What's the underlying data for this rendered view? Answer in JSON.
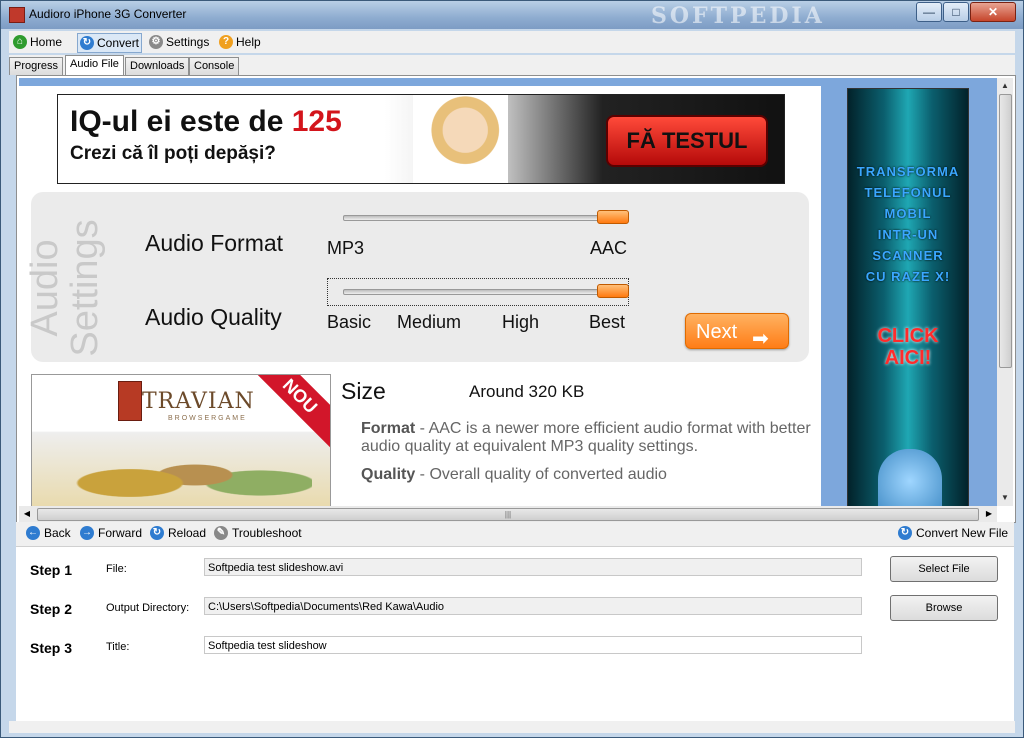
{
  "window": {
    "title": "Audioro iPhone 3G Converter",
    "watermark": "SOFTPEDIA",
    "min_glyph": "—",
    "max_glyph": "□",
    "close_glyph": "✕"
  },
  "menu": {
    "items": [
      {
        "label": "Home"
      },
      {
        "label": "Convert"
      },
      {
        "label": "Settings"
      },
      {
        "label": "Help"
      }
    ]
  },
  "tabs": [
    "Progress",
    "Audio File",
    "Downloads",
    "Console"
  ],
  "active_tab": "Audio File",
  "ad_top": {
    "line1_prefix": "IQ-ul ei este de ",
    "line1_number": "125",
    "line2": "Crezi că îl poți depăși?",
    "button": "FĂ TESTUL"
  },
  "audio_settings": {
    "panel_title": "Audio Settings",
    "format": {
      "label": "Audio Format",
      "options": [
        "MP3",
        "AAC"
      ],
      "selected": "AAC"
    },
    "quality": {
      "label": "Audio Quality",
      "options": [
        "Basic",
        "Medium",
        "High",
        "Best"
      ],
      "selected": "Best"
    },
    "next_label": "Next",
    "next_arrow": "➡"
  },
  "travian_ad": {
    "logo": "TRAVIAN",
    "subtitle": "BROWSERGAME",
    "badge": "NOU"
  },
  "size": {
    "label": "Size",
    "value": "Around 320 KB"
  },
  "descriptions": [
    {
      "term": "Format",
      "text": " - AAC is a newer more efficient audio format with better audio quality at equivalent MP3 quality settings."
    },
    {
      "term": "Quality",
      "text": " - Overall quality of converted audio"
    }
  ],
  "ad_right": {
    "lines": [
      "TRANSFORMA",
      "TELEFONUL",
      "MOBIL",
      "INTR-UN",
      "SCANNER",
      "CU RAZE X!"
    ],
    "click_line1": "CLICK",
    "click_line2": "AICI!"
  },
  "scroll_glyphs": {
    "up": "▲",
    "down": "▼",
    "left": "◀",
    "right": "▶",
    "grip": "|||"
  },
  "nav": {
    "back": "Back",
    "forward": "Forward",
    "reload": "Reload",
    "troubleshoot": "Troubleshoot",
    "convert_new": "Convert New File"
  },
  "form": {
    "step1": {
      "step": "Step 1",
      "label": "File:",
      "value": "Softpedia test slideshow.avi",
      "button": "Select File"
    },
    "step2": {
      "step": "Step 2",
      "label": "Output Directory:",
      "value": "C:\\Users\\Softpedia\\Documents\\Red Kawa\\Audio",
      "button": "Browse"
    },
    "step3": {
      "step": "Step 3",
      "label": "Title:",
      "value": "Softpedia test slideshow"
    }
  },
  "icons": {
    "home": "home-icon",
    "convert": "convert-icon",
    "settings": "gear-icon",
    "help": "help-icon",
    "back": "back-arrow-icon",
    "forward": "forward-arrow-icon",
    "reload": "reload-icon",
    "troubleshoot": "wrench-icon"
  },
  "colors": {
    "accent_orange": "#ff7d17",
    "iq_red": "#d3141b",
    "page_bg": "#7da7dc"
  }
}
